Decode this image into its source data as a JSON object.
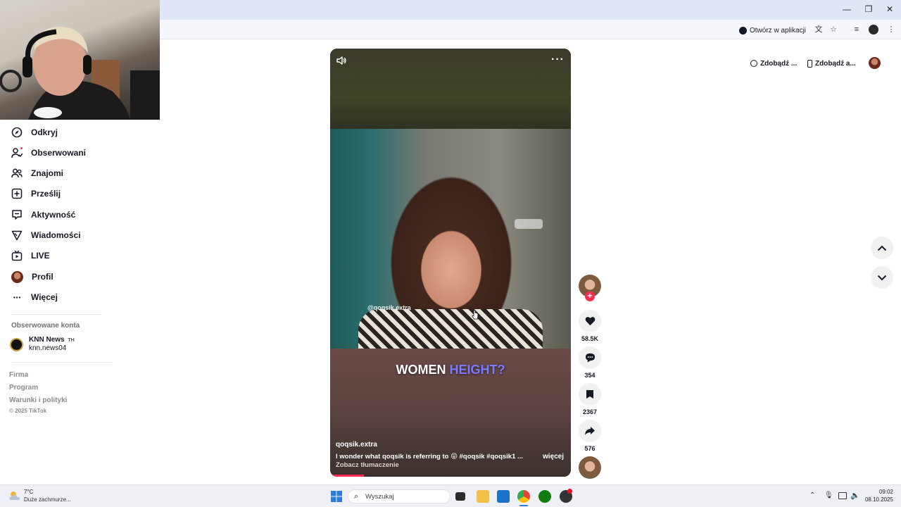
{
  "browser": {
    "open_in_app": "Otwórz w aplikacji"
  },
  "sidebar": {
    "items": [
      {
        "label": "Odkryj",
        "icon": "compass-icon"
      },
      {
        "label": "Obserwowani",
        "icon": "following-icon"
      },
      {
        "label": "Znajomi",
        "icon": "friends-icon"
      },
      {
        "label": "Prześlij",
        "icon": "upload-icon"
      },
      {
        "label": "Aktywność",
        "icon": "activity-icon"
      },
      {
        "label": "Wiadomości",
        "icon": "messages-icon"
      },
      {
        "label": "LIVE",
        "icon": "live-icon"
      },
      {
        "label": "Profil",
        "icon": "avatar"
      },
      {
        "label": "Więcej",
        "icon": "more-icon"
      }
    ],
    "followed_title": "Obserwowane konta",
    "followed": [
      {
        "name": "KNN News",
        "badge": "TH",
        "handle": "knn.news04"
      }
    ],
    "footer": {
      "links": [
        "Firma",
        "Program",
        "Warunki i polityki"
      ],
      "copyright": "© 2025 TikTok"
    }
  },
  "header": {
    "get_coins": "Zdobądź ...",
    "get_app": "Zdobądź a..."
  },
  "video": {
    "watermark": "@qoqsik.extra",
    "caption_big_1": "WOMEN",
    "caption_big_2": "HEIGHT?",
    "author": "qoqsik.extra",
    "description": "I wonder what qoqsik is referring to 😝 #qoqsik  #qoqsik1  ...",
    "more": "więcej",
    "translate": "Zobacz tłumaczenie",
    "progress_percent": 14
  },
  "actions": {
    "likes": "58.5K",
    "comments": "354",
    "saves": "2367",
    "shares": "576"
  },
  "taskbar": {
    "weather_temp": "7°C",
    "weather_desc": "Duże zachmurze...",
    "search_placeholder": "Wyszukaj",
    "time": "09:02",
    "date": "08.10.2025"
  },
  "colors": {
    "accent": "#fe2c55",
    "caption_highlight": "#7b7bff"
  }
}
